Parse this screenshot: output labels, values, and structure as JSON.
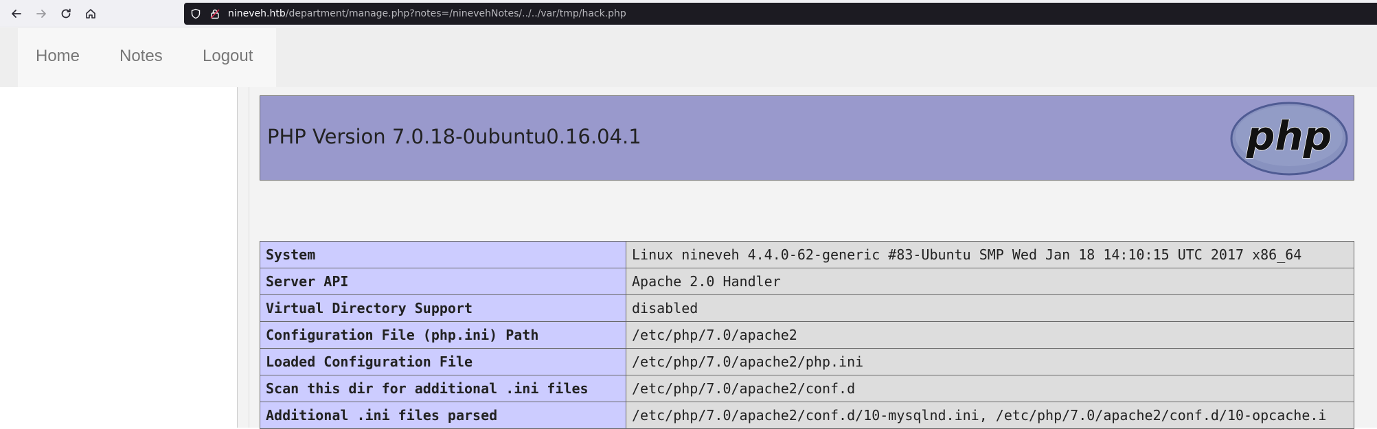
{
  "browser": {
    "url_host": "nineveh.htb",
    "url_path": "/department/manage.php?notes=/ninevehNotes/../../var/tmp/hack.php",
    "back_icon": "arrow-left-icon",
    "forward_icon": "arrow-right-icon",
    "reload_icon": "reload-icon",
    "home_icon": "home-icon"
  },
  "nav": {
    "items": [
      {
        "label": "Home"
      },
      {
        "label": "Notes"
      },
      {
        "label": "Logout"
      }
    ]
  },
  "phpinfo": {
    "version_title": "PHP Version 7.0.18-0ubuntu0.16.04.1",
    "logo_text": "php",
    "rows": [
      {
        "key": "System",
        "value": "Linux nineveh 4.4.0-62-generic #83-Ubuntu SMP Wed Jan 18 14:10:15 UTC 2017 x86_64"
      },
      {
        "key": "Server API",
        "value": "Apache 2.0 Handler"
      },
      {
        "key": "Virtual Directory Support",
        "value": "disabled"
      },
      {
        "key": "Configuration File (php.ini) Path",
        "value": "/etc/php/7.0/apache2"
      },
      {
        "key": "Loaded Configuration File",
        "value": "/etc/php/7.0/apache2/php.ini"
      },
      {
        "key": "Scan this dir for additional .ini files",
        "value": "/etc/php/7.0/apache2/conf.d"
      },
      {
        "key": "Additional .ini files parsed",
        "value": "/etc/php/7.0/apache2/conf.d/10-mysqlnd.ini, /etc/php/7.0/apache2/conf.d/10-opcache.i"
      }
    ]
  },
  "colors": {
    "header_bg": "#9999cc",
    "key_bg": "#ccccff",
    "value_bg": "#dddddd"
  }
}
